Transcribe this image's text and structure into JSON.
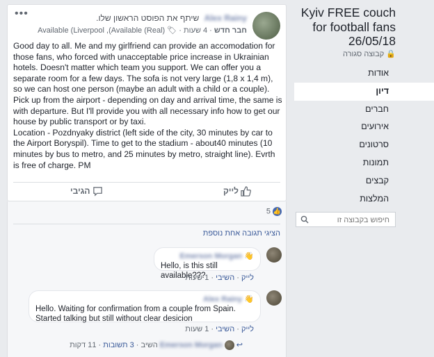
{
  "post": {
    "author": "Alex Rainy",
    "shared_text": "שיתף את הפוסט הראשון שלו.",
    "tag": "חבר חדש",
    "time": "4 שעות",
    "location": "(Available (Liverpool ,(Available (Real",
    "menu": "•••",
    "body": [
      "Good day to all. Me and my girlfriend can provide an accomodation for those fans, who forced with unacceptable price increase in Ukrainian hotels. Doesn't matter which team you support. We can offer you a separate room for a few days. The sofa is not very large (1,8 x 1,4 m), so we can host one person (maybe an adult with a child or a couple). Pick up from the airport - depending on day and arrival time, the same is with departure. But I'll provide you with all necessary info how to get our house by public transport or by taxi.",
      "Location - Pozdnyaky district (left side of the city, 30 minutes by car to the Airport Boryspil). Time to get to the stadium - about40 minutes (10 minutes by bus to metro, and 25 minutes by metro, straight line). Evrth is free of charge. PM"
    ],
    "like_label": "לייק",
    "comment_label": "הגיבי"
  },
  "reactions": {
    "count": "5"
  },
  "comments": {
    "more_replies": "הציגי תגובה אחת נוספת",
    "items": [
      {
        "name": "Emerson Morgan",
        "text": "Hello, is this still available???",
        "like": "לייק",
        "reply": "השיבי",
        "time": "1 שעות"
      },
      {
        "name": "Alex Rainy",
        "text": "Hello. Waiting for confirmation from a couple from Spain. Started talking but still without clear desicion",
        "like": "לייק",
        "reply": "השיבי",
        "time": "1 שעות"
      }
    ],
    "reply_summary": {
      "name": "Emerson Morgan",
      "verb": "השיב",
      "count": "3 תשובות",
      "time": "11 דקות"
    }
  },
  "sidebar": {
    "group_title": "Kyiv FREE couch for football fans 26/05/18",
    "group_type": "קבוצה סגורה",
    "nav": [
      "אודות",
      "דיון",
      "חברים",
      "אירועים",
      "סרטונים",
      "תמונות",
      "קבצים",
      "המלצות"
    ],
    "active_index": 1,
    "search_placeholder": "חיפוש בקבוצה זו"
  },
  "colors": {
    "link": "#385898",
    "like_badge": "#4267b2",
    "background": "#e9ebee"
  }
}
